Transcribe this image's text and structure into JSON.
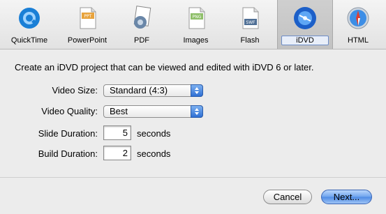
{
  "toolbar": {
    "items": [
      {
        "label": "QuickTime",
        "icon": "quicktime-icon"
      },
      {
        "label": "PowerPoint",
        "icon": "powerpoint-icon",
        "badge": "PPT"
      },
      {
        "label": "PDF",
        "icon": "pdf-icon"
      },
      {
        "label": "Images",
        "icon": "images-icon",
        "badge": "PNG"
      },
      {
        "label": "Flash",
        "icon": "flash-icon",
        "badge": "SWF"
      },
      {
        "label": "iDVD",
        "icon": "idvd-icon",
        "selected": true
      },
      {
        "label": "HTML",
        "icon": "html-icon"
      }
    ]
  },
  "description": "Create an iDVD project that can be viewed and edited with iDVD 6 or later.",
  "form": {
    "video_size": {
      "label": "Video Size:",
      "value": "Standard (4:3)"
    },
    "video_quality": {
      "label": "Video Quality:",
      "value": "Best"
    },
    "slide_duration": {
      "label": "Slide Duration:",
      "value": "5",
      "unit": "seconds"
    },
    "build_duration": {
      "label": "Build Duration:",
      "value": "2",
      "unit": "seconds"
    }
  },
  "buttons": {
    "cancel": "Cancel",
    "next": "Next..."
  },
  "colors": {
    "accent": "#4d8ae4",
    "background": "#ececec"
  }
}
